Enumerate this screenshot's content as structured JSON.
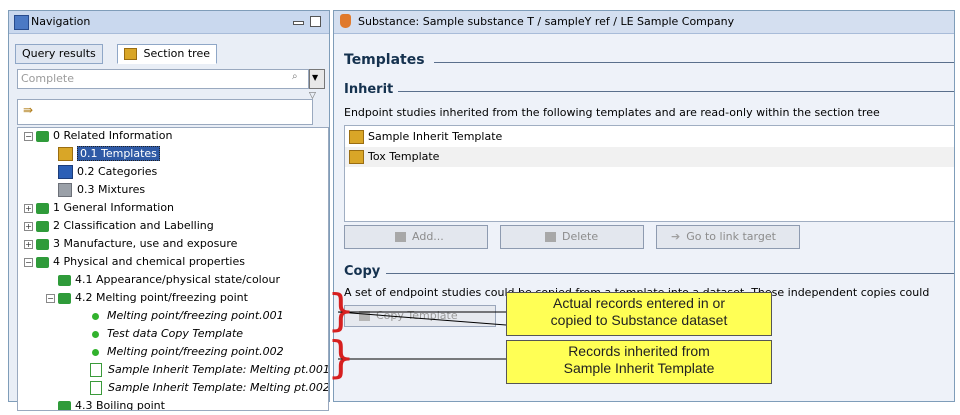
{
  "navigation": {
    "title": "Navigation",
    "tabs": [
      "Query results",
      "Section tree"
    ],
    "filter_placeholder": "Complete",
    "tree": [
      {
        "label": "0 Related Information"
      },
      {
        "label": "0.1 Templates"
      },
      {
        "label": "0.2 Categories"
      },
      {
        "label": "0.3 Mixtures"
      },
      {
        "label": "1 General Information"
      },
      {
        "label": "2 Classification and Labelling"
      },
      {
        "label": "3 Manufacture, use and exposure"
      },
      {
        "label": "4 Physical and chemical properties"
      },
      {
        "label": "4.1 Appearance/physical state/colour"
      },
      {
        "label": "4.2 Melting point/freezing point"
      },
      {
        "label": "Melting point/freezing point.001"
      },
      {
        "label": "Test data Copy Template"
      },
      {
        "label": "Melting point/freezing point.002"
      },
      {
        "label": "Sample Inherit Template: Melting pt.001"
      },
      {
        "label": "Sample Inherit Template: Melting pt.002"
      },
      {
        "label": "4.3 Boiling point"
      }
    ]
  },
  "substance": {
    "title": "Substance: Sample substance T / sampleY ref / LE Sample Company",
    "section_title": "Templates",
    "inherit": {
      "heading": "Inherit",
      "description": "Endpoint studies inherited from the following templates and are read-only within the section tree",
      "items": [
        "Sample Inherit Template",
        "Tox Template"
      ],
      "buttons": {
        "add": "Add...",
        "delete": "Delete",
        "go_to_link": "Go to link target"
      }
    },
    "copy": {
      "heading": "Copy",
      "description": "A set of endpoint studies could be copied from a template into a dataset. These independent copies could",
      "button": "Copy Template"
    }
  },
  "callouts": {
    "actual_records": [
      "Actual records entered in or",
      "copied to Substance dataset"
    ],
    "inherited_records": [
      "Records inherited from",
      "Sample Inherit Template"
    ]
  },
  "colors": {
    "callout_fill": "#ffff55",
    "brace": "#d62020",
    "selection": "#2f5aa6"
  }
}
